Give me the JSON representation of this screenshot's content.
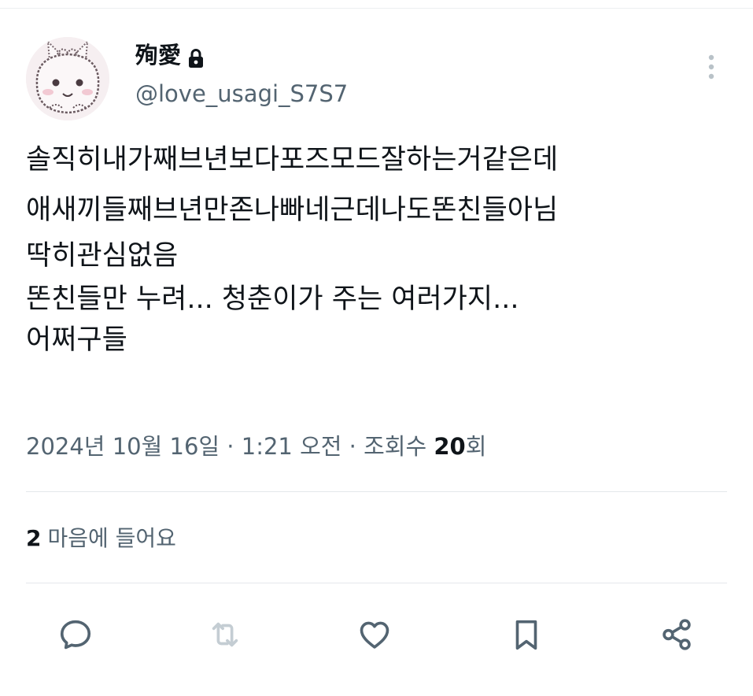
{
  "colors": {
    "text_primary": "#0f1419",
    "text_secondary": "#536471",
    "icon_active": "#536471",
    "icon_disabled": "#c4cdd3",
    "divider": "#e4e8eb"
  },
  "author": {
    "display_name": "殉愛",
    "handle": "@love_usagi_S7S7",
    "avatar_icon": "bunny-avatar",
    "lock_icon": "lock-icon"
  },
  "tweet": {
    "lines": [
      "솔직히내가째브년보다포즈모드잘하는거같은데",
      "애새끼들째브년만존나빠네근데나도똔친들아님",
      "딱히관심없음",
      "똔친들만 누려... 청춘이가 주는 여러가지...",
      "어쩌구들"
    ]
  },
  "meta": {
    "datetime": "2024년 10월 16일 · 1:21 오전 · 조회수 ",
    "views_count": "20",
    "views_suffix": "회"
  },
  "stats": {
    "likes_count": "2",
    "likes_label": "마음에 들어요"
  },
  "actions": [
    {
      "name": "reply",
      "icon": "comment-icon"
    },
    {
      "name": "retweet",
      "icon": "retweet-icon",
      "disabled": true
    },
    {
      "name": "like",
      "icon": "heart-icon"
    },
    {
      "name": "bookmark",
      "icon": "bookmark-icon"
    },
    {
      "name": "share",
      "icon": "share-icon"
    }
  ],
  "menu_icon": "more-vertical-icon"
}
